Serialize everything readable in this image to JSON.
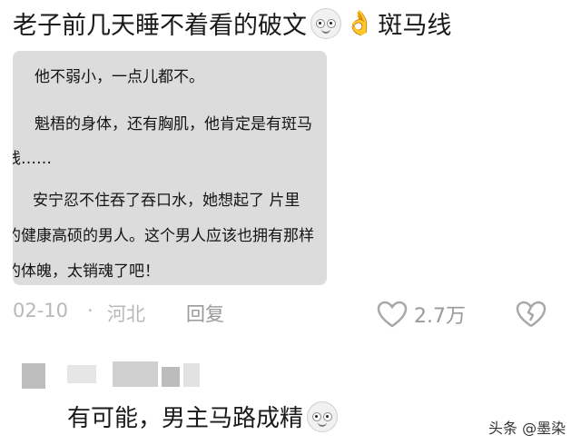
{
  "post": {
    "text": "老子前几天睡不着看的破文",
    "tail_text": "斑马线",
    "emojis": [
      "grin-face-icon",
      "ok-hand-icon"
    ]
  },
  "screenshot_lines": [
    "他不弱小，一点儿都不。",
    "魁梧的身体，还有胸肌，他肯定是有斑马",
    "线……",
    "安宁忍不住吞了吞口水，她想起了 片里",
    "的健康高硕的男人。这个男人应该也拥有那样",
    "的体魄，太销魂了吧！"
  ],
  "meta": {
    "date": "02-10",
    "separator": "·",
    "location": "河北",
    "reply_label": "回复",
    "like_count": "2.7万"
  },
  "reply": {
    "text": "有可能，男主马路成精"
  },
  "watermark": "头条 @墨染",
  "colors": {
    "meta_gray": "#b8b8b8",
    "card_bg": "#dcdcdc"
  }
}
